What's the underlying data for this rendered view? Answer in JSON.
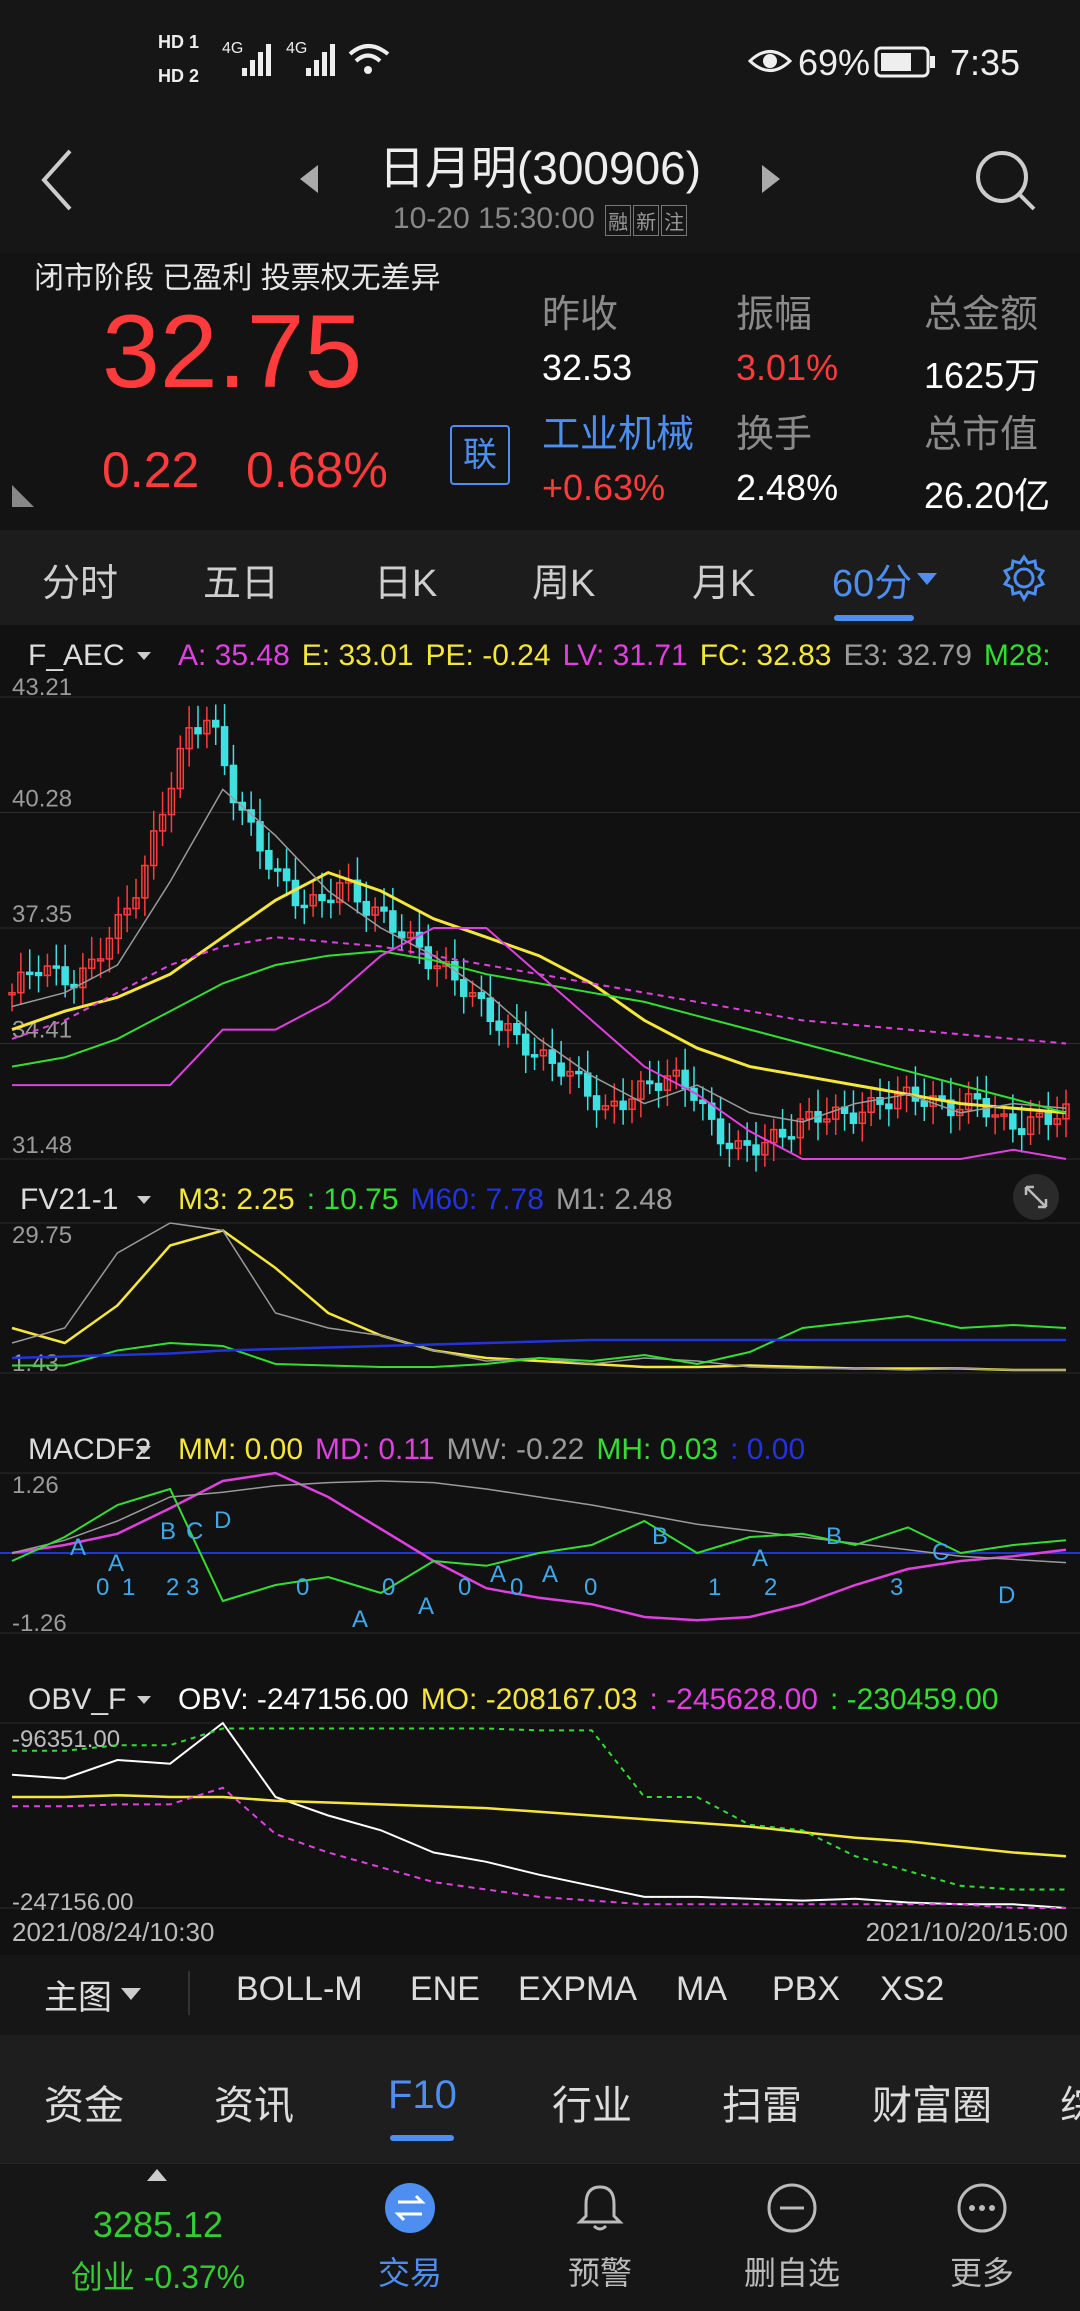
{
  "status_bar": {
    "hd1": "HD 1",
    "hd2": "HD 2",
    "net1": "4G",
    "net2": "4G",
    "battery": "69%",
    "time": "7:35"
  },
  "header": {
    "title": "日月明(300906)",
    "datetime": "10-20 15:30:00",
    "tags": [
      "融",
      "新",
      "注"
    ]
  },
  "quote": {
    "status": "闭市阶段  已盈利  投票权无差异",
    "price": "32.75",
    "change": "0.22",
    "change_pct": "0.68%",
    "lian_button": "联",
    "stats": [
      {
        "label": "昨收",
        "value": "32.53",
        "color": "#ffffff"
      },
      {
        "label": "振幅",
        "value": "3.01%",
        "color": "#ff3b3b"
      },
      {
        "label": "总金额",
        "value": "1625万",
        "color": "#ffffff"
      },
      {
        "label": "工业机械",
        "value": "+0.63%",
        "color": "#ff3b3b"
      },
      {
        "label": "换手",
        "value": "2.48%",
        "color": "#ffffff"
      },
      {
        "label": "总市值",
        "value": "26.20亿",
        "color": "#ffffff"
      }
    ]
  },
  "period_tabs": [
    "分时",
    "五日",
    "日K",
    "周K",
    "月K",
    "60分"
  ],
  "active_period": "60分",
  "main_chart": {
    "indicator": "F_AEC",
    "legend": [
      {
        "label": "A: 35.48",
        "color": "#e040e0"
      },
      {
        "label": "E: 33.01",
        "color": "#f5e63c"
      },
      {
        "label": "PE: -0.24",
        "color": "#f5e63c"
      },
      {
        "label": "LV: 31.71",
        "color": "#e040e0"
      },
      {
        "label": "FC: 32.83",
        "color": "#f5e63c"
      },
      {
        "label": "E3: 32.79",
        "color": "#9a9a9a"
      },
      {
        "label": "M28:",
        "color": "#33dd33"
      }
    ],
    "y_ticks": [
      "43.21",
      "40.28",
      "37.35",
      "34.41",
      "31.48"
    ]
  },
  "fv_chart": {
    "indicator": "FV21-1",
    "legend": [
      {
        "label": "M3: 2.25",
        "color": "#f5e63c"
      },
      {
        "label": ": 10.75",
        "color": "#33dd33"
      },
      {
        "label": "M60: 7.78",
        "color": "#2233dd"
      },
      {
        "label": "M1: 2.48",
        "color": "#9a9a9a"
      }
    ],
    "y_ticks": [
      "29.75",
      "1.43"
    ]
  },
  "macd_chart": {
    "indicator": "MACDF2",
    "legend": [
      {
        "label": "MM: 0.00",
        "color": "#f5e63c"
      },
      {
        "label": "MD: 0.11",
        "color": "#e040e0"
      },
      {
        "label": "MW: -0.22",
        "color": "#9a9a9a"
      },
      {
        "label": "MH: 0.03",
        "color": "#33dd33"
      },
      {
        "label": ": 0.00",
        "color": "#2233dd"
      }
    ],
    "y_ticks": [
      "1.26",
      "-1.26"
    ]
  },
  "obv_chart": {
    "indicator": "OBV_F",
    "legend": [
      {
        "label": "OBV: -247156.00",
        "color": "#ffffff"
      },
      {
        "label": "MO: -208167.03",
        "color": "#f5e63c"
      },
      {
        "label": ": -245628.00",
        "color": "#e040e0"
      },
      {
        "label": ": -230459.00",
        "color": "#33dd33"
      }
    ],
    "y_ticks": [
      "-96351.00",
      "-247156.00"
    ],
    "x_start": "2021/08/24/10:30",
    "x_end": "2021/10/20/15:00"
  },
  "indicator_tabs": {
    "main_label": "主图",
    "items": [
      "BOLL-M",
      "ENE",
      "EXPMA",
      "MA",
      "PBX",
      "XS2"
    ]
  },
  "bottom_tabs": [
    "资金",
    "资讯",
    "F10",
    "行业",
    "扫雷",
    "财富圈",
    "综"
  ],
  "active_bottom_tab": "F10",
  "dock": {
    "index_value": "3285.12",
    "index_label": "创业 -0.37%",
    "items": [
      "交易",
      "预警",
      "删自选",
      "更多"
    ]
  },
  "colors": {
    "red": "#ff3b3b",
    "blue": "#4d8ef0",
    "yellow": "#f5e63c",
    "magenta": "#e040e0",
    "green": "#33dd33",
    "cyan": "#40e0e0"
  }
}
